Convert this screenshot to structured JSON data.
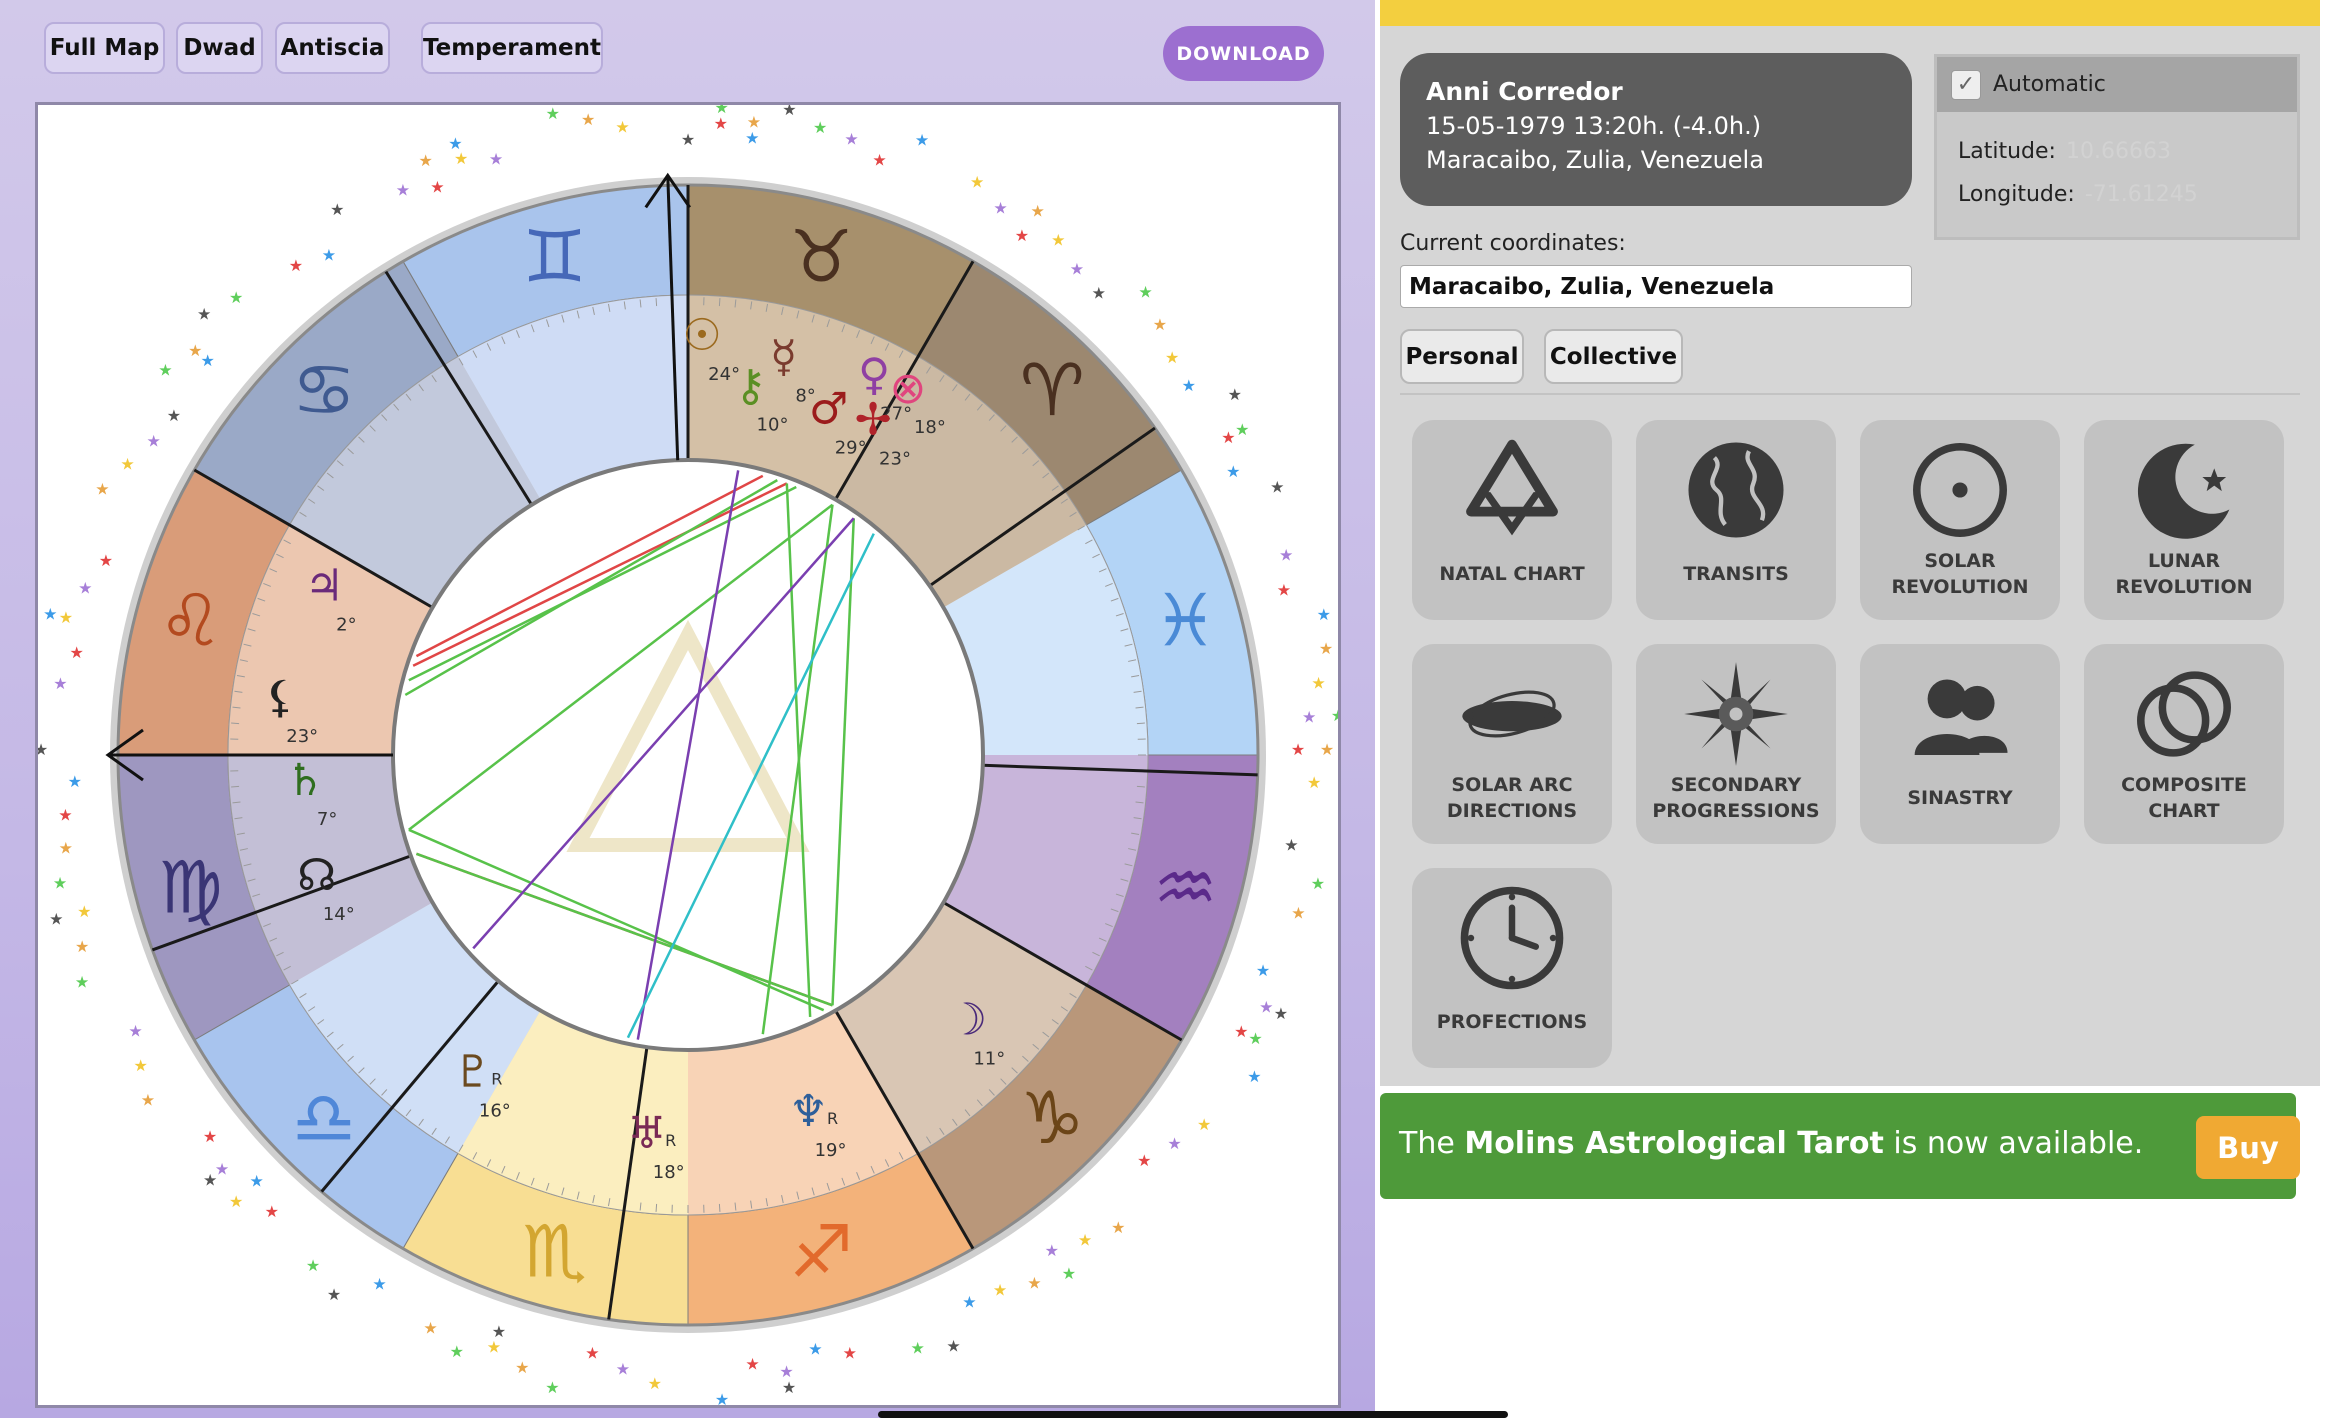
{
  "toolbar": {
    "buttons": [
      "Full Map",
      "Dwad",
      "Antiscia",
      "Temperament"
    ],
    "download_label": "DOWNLOAD"
  },
  "chart": {
    "signs": [
      {
        "name": "Aries",
        "glyph": "♈"
      },
      {
        "name": "Taurus",
        "glyph": "♉"
      },
      {
        "name": "Gemini",
        "glyph": "♊"
      },
      {
        "name": "Cancer",
        "glyph": "♋"
      },
      {
        "name": "Leo",
        "glyph": "♌"
      },
      {
        "name": "Virgo",
        "glyph": "♍"
      },
      {
        "name": "Libra",
        "glyph": "♎"
      },
      {
        "name": "Scorpio",
        "glyph": "♏"
      },
      {
        "name": "Sagittarius",
        "glyph": "♐"
      },
      {
        "name": "Capricorn",
        "glyph": "♑"
      },
      {
        "name": "Aquarius",
        "glyph": "♒"
      },
      {
        "name": "Pisces",
        "glyph": "♓"
      }
    ],
    "planets": [
      {
        "name": "sun",
        "glyph": "☉",
        "degree": "24°",
        "color": "#9b6a1f"
      },
      {
        "name": "mercury",
        "glyph": "☿",
        "degree": "8°",
        "color": "#7a3b2e"
      },
      {
        "name": "venus",
        "glyph": "♀",
        "degree": "27°",
        "color": "#8f3fa3"
      },
      {
        "name": "chiron",
        "glyph": "⚷",
        "degree": "10°",
        "color": "#5b8f24"
      },
      {
        "name": "mars",
        "glyph": "♂",
        "degree": "29°",
        "color": "#9b1c1c"
      },
      {
        "name": "part-of-fortune",
        "glyph": "⊗",
        "degree": "18°",
        "color": "#e0457e"
      },
      {
        "name": "vertex",
        "glyph": "✢",
        "degree": "23°",
        "color": "#b0232a"
      },
      {
        "name": "jupiter",
        "glyph": "♃",
        "degree": "2°",
        "color": "#6a2a7a"
      },
      {
        "name": "lilith",
        "glyph": "⚸",
        "degree": "23°",
        "color": "#222222"
      },
      {
        "name": "saturn",
        "glyph": "♄",
        "degree": "7°",
        "color": "#2f6e1f"
      },
      {
        "name": "node",
        "glyph": "☊",
        "degree": "14°",
        "color": "#222222"
      },
      {
        "name": "pluto",
        "glyph": "♇",
        "degree": "16°",
        "color": "#6b4a1f"
      },
      {
        "name": "uranus",
        "glyph": "♅",
        "degree": "18°",
        "color": "#7a2a55"
      },
      {
        "name": "neptune",
        "glyph": "♆",
        "degree": "19°",
        "color": "#2e5f9a"
      },
      {
        "name": "moon",
        "glyph": "☽",
        "degree": "11°",
        "color": "#4a2a7a"
      }
    ],
    "retrograde_marker": "R"
  },
  "profile": {
    "name": "Anni Corredor",
    "datetime": "15-05-1979 13:20h. (-4.0h.)",
    "place": "Maracaibo, Zulia, Venezuela"
  },
  "geo": {
    "automatic_label": "Automatic",
    "checked": true,
    "latitude_label": "Latitude:",
    "latitude_value": "10.66663",
    "longitude_label": "Longitude:",
    "longitude_value": "-71.61245"
  },
  "coords": {
    "label": "Current coordinates:",
    "value": "Maracaibo, Zulia, Venezuela"
  },
  "modes": [
    "Personal",
    "Collective"
  ],
  "tiles": [
    {
      "id": "natal-chart",
      "label": "NATAL CHART",
      "icon": "natal-chart-icon"
    },
    {
      "id": "transits",
      "label": "TRANSITS",
      "icon": "globe-icon"
    },
    {
      "id": "solar-revolution",
      "label": "SOLAR REVOLUTION",
      "icon": "sun-icon"
    },
    {
      "id": "lunar-revolution",
      "label": "LUNAR REVOLUTION",
      "icon": "moon-star-icon"
    },
    {
      "id": "solar-arc-directions",
      "label": "SOLAR ARC DIRECTIONS",
      "icon": "orbit-icon"
    },
    {
      "id": "secondary-progressions",
      "label": "SECONDARY PROGRESSIONS",
      "icon": "compass-rose-icon"
    },
    {
      "id": "sinastry",
      "label": "SINASTRY",
      "icon": "people-icon"
    },
    {
      "id": "composite-chart",
      "label": "COMPOSITE CHART",
      "icon": "rings-icon"
    },
    {
      "id": "profections",
      "label": "PROFECTIONS",
      "icon": "clock-icon"
    }
  ],
  "promo": {
    "prefix": "The ",
    "highlight": "Molins Astrological Tarot",
    "suffix": " is now available.",
    "buy_label": "Buy"
  }
}
